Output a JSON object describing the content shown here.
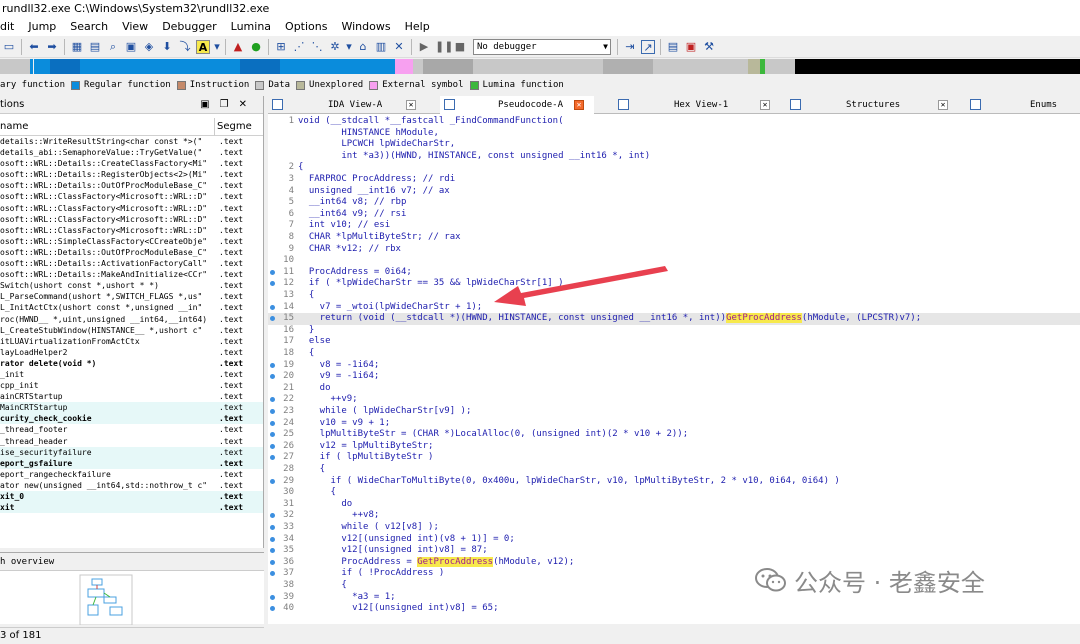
{
  "window": {
    "title": "rundll32.exe C:\\Windows\\System32\\rundll32.exe"
  },
  "menu": [
    "dit",
    "Jump",
    "Search",
    "View",
    "Debugger",
    "Lumina",
    "Options",
    "Windows",
    "Help"
  ],
  "toolbar": {
    "debugger_select": "No debugger"
  },
  "legend": [
    {
      "label": "ary function",
      "color": "#e8e8b0"
    },
    {
      "label": "Regular function",
      "color": "#0a8cdc"
    },
    {
      "label": "Instruction",
      "color": "#c58a6a"
    },
    {
      "label": "Data",
      "color": "#c8c8c8"
    },
    {
      "label": "Unexplored",
      "color": "#b8b89a"
    },
    {
      "label": "External symbol",
      "color": "#f7a0f0"
    },
    {
      "label": "Lumina function",
      "color": "#3cb83c"
    }
  ],
  "functions_panel": {
    "title": "tions",
    "col_name": " name",
    "col_segment": "Segme",
    "rows": [
      {
        "name": "details::WriteResultString<char const *>(\"",
        "seg": ".text",
        "hl": false,
        "bold": false
      },
      {
        "name": "details_abi::SemaphoreValue::TryGetValue(\"",
        "seg": ".text",
        "hl": false,
        "bold": false
      },
      {
        "name": "osoft::WRL::Details::CreateClassFactory<Mi\"",
        "seg": ".text",
        "hl": false,
        "bold": false
      },
      {
        "name": "osoft::WRL::Details::RegisterObjects<2>(Mi\"",
        "seg": ".text",
        "hl": false,
        "bold": false
      },
      {
        "name": "osoft::WRL::Details::OutOfProcModuleBase_C\"",
        "seg": ".text",
        "hl": false,
        "bold": false
      },
      {
        "name": "osoft::WRL::ClassFactory<Microsoft::WRL::D\"",
        "seg": ".text",
        "hl": false,
        "bold": false
      },
      {
        "name": "osoft::WRL::ClassFactory<Microsoft::WRL::D\"",
        "seg": ".text",
        "hl": false,
        "bold": false
      },
      {
        "name": "osoft::WRL::ClassFactory<Microsoft::WRL::D\"",
        "seg": ".text",
        "hl": false,
        "bold": false
      },
      {
        "name": "osoft::WRL::ClassFactory<Microsoft::WRL::D\"",
        "seg": ".text",
        "hl": false,
        "bold": false
      },
      {
        "name": "osoft::WRL::SimpleClassFactory<CCreateObje\"",
        "seg": ".text",
        "hl": false,
        "bold": false
      },
      {
        "name": "osoft::WRL::Details::OutOfProcModuleBase_C\"",
        "seg": ".text",
        "hl": false,
        "bold": false
      },
      {
        "name": "osoft::WRL::Details::ActivationFactoryCall\"",
        "seg": ".text",
        "hl": false,
        "bold": false
      },
      {
        "name": "osoft::WRL::Details::MakeAndInitialize<CCr\"",
        "seg": ".text",
        "hl": false,
        "bold": false
      },
      {
        "name": "Switch(ushort const *,ushort * *)",
        "seg": ".text",
        "hl": false,
        "bold": false
      },
      {
        "name": "L_ParseCommand(ushort *,SWITCH_FLAGS *,us\"",
        "seg": ".text",
        "hl": false,
        "bold": false
      },
      {
        "name": "L_InitActCtx(ushort const *,unsigned __in\"",
        "seg": ".text",
        "hl": false,
        "bold": false
      },
      {
        "name": "roc(HWND__ *,uint,unsigned __int64,__int64)",
        "seg": ".text",
        "hl": false,
        "bold": false
      },
      {
        "name": "L_CreateStubWindow(HINSTANCE__ *,ushort c\"",
        "seg": ".text",
        "hl": false,
        "bold": false
      },
      {
        "name": "itLUAVirtualizationFromActCtx",
        "seg": ".text",
        "hl": false,
        "bold": false
      },
      {
        "name": "layLoadHelper2",
        "seg": ".text",
        "hl": false,
        "bold": false
      },
      {
        "name": "rator delete(void *)",
        "seg": ".text",
        "hl": false,
        "bold": true
      },
      {
        "name": "_init",
        "seg": ".text",
        "hl": false,
        "bold": false
      },
      {
        "name": "cpp_init",
        "seg": ".text",
        "hl": false,
        "bold": false
      },
      {
        "name": "ainCRTStartup",
        "seg": ".text",
        "hl": false,
        "bold": false
      },
      {
        "name": "MainCRTStartup",
        "seg": ".text",
        "hl": true,
        "bold": false
      },
      {
        "name": "curity_check_cookie",
        "seg": ".text",
        "hl": true,
        "bold": true
      },
      {
        "name": "_thread_footer",
        "seg": ".text",
        "hl": false,
        "bold": false
      },
      {
        "name": "_thread_header",
        "seg": ".text",
        "hl": false,
        "bold": false
      },
      {
        "name": "ise_securityfailure",
        "seg": ".text",
        "hl": true,
        "bold": false
      },
      {
        "name": "eport_gsfailure",
        "seg": ".text",
        "hl": true,
        "bold": true
      },
      {
        "name": "eport_rangecheckfailure",
        "seg": ".text",
        "hl": false,
        "bold": false
      },
      {
        "name": "ator new(unsigned __int64,std::nothrow_t c\"",
        "seg": ".text",
        "hl": false,
        "bold": false
      },
      {
        "name": "xit_0",
        "seg": ".text",
        "hl": true,
        "bold": true
      },
      {
        "name": "xit",
        "seg": ".text",
        "hl": true,
        "bold": true
      }
    ],
    "status": "3 of 181"
  },
  "overview_panel": {
    "title": "h overview"
  },
  "tabs": [
    {
      "label": "IDA View-A",
      "active": false
    },
    {
      "label": "Pseudocode-A",
      "active": true
    },
    {
      "label": "Hex View-1",
      "active": false
    },
    {
      "label": "Structures",
      "active": false
    },
    {
      "label": "Enums",
      "active": false
    }
  ],
  "code_lines": [
    {
      "n": "1",
      "dot": false,
      "text": "void (__stdcall *__fastcall _FindCommandFunction("
    },
    {
      "n": "",
      "dot": false,
      "text": "        HINSTANCE hModule,"
    },
    {
      "n": "",
      "dot": false,
      "text": "        LPCWCH lpWideCharStr,"
    },
    {
      "n": "",
      "dot": false,
      "text": "        int *a3))(HWND, HINSTANCE, const unsigned __int16 *, int)"
    },
    {
      "n": "2",
      "dot": false,
      "text": "{"
    },
    {
      "n": "3",
      "dot": false,
      "text": "  FARPROC ProcAddress; // rdi"
    },
    {
      "n": "4",
      "dot": false,
      "text": "  unsigned __int16 v7; // ax"
    },
    {
      "n": "5",
      "dot": false,
      "text": "  __int64 v8; // rbp"
    },
    {
      "n": "6",
      "dot": false,
      "text": "  __int64 v9; // rsi"
    },
    {
      "n": "7",
      "dot": false,
      "text": "  int v10; // esi"
    },
    {
      "n": "8",
      "dot": false,
      "text": "  CHAR *lpMultiByteStr; // rax"
    },
    {
      "n": "9",
      "dot": false,
      "text": "  CHAR *v12; // rbx"
    },
    {
      "n": "10",
      "dot": false,
      "text": ""
    },
    {
      "n": "11",
      "dot": true,
      "text": "  ProcAddress = 0i64;"
    },
    {
      "n": "12",
      "dot": true,
      "text": "  if ( *lpWideCharStr == 35 && lpWideCharStr[1] )"
    },
    {
      "n": "13",
      "dot": false,
      "text": "  {"
    },
    {
      "n": "14",
      "dot": true,
      "text": "    v7 = _wtoi(lpWideCharStr + 1);"
    },
    {
      "n": "15",
      "dot": true,
      "text": "    return (void (__stdcall *)(HWND, HINSTANCE, const unsigned __int16 *, int))GetProcAddress(hModule, (LPCSTR)v7);",
      "cur": true
    },
    {
      "n": "16",
      "dot": false,
      "text": "  }"
    },
    {
      "n": "17",
      "dot": false,
      "text": "  else"
    },
    {
      "n": "18",
      "dot": false,
      "text": "  {"
    },
    {
      "n": "19",
      "dot": true,
      "text": "    v8 = -1i64;"
    },
    {
      "n": "20",
      "dot": true,
      "text": "    v9 = -1i64;"
    },
    {
      "n": "21",
      "dot": false,
      "text": "    do"
    },
    {
      "n": "22",
      "dot": true,
      "text": "      ++v9;"
    },
    {
      "n": "23",
      "dot": true,
      "text": "    while ( lpWideCharStr[v9] );"
    },
    {
      "n": "24",
      "dot": true,
      "text": "    v10 = v9 + 1;"
    },
    {
      "n": "25",
      "dot": true,
      "text": "    lpMultiByteStr = (CHAR *)LocalAlloc(0, (unsigned int)(2 * v10 + 2));"
    },
    {
      "n": "26",
      "dot": true,
      "text": "    v12 = lpMultiByteStr;"
    },
    {
      "n": "27",
      "dot": true,
      "text": "    if ( lpMultiByteStr )"
    },
    {
      "n": "28",
      "dot": false,
      "text": "    {"
    },
    {
      "n": "29",
      "dot": true,
      "text": "      if ( WideCharToMultiByte(0, 0x400u, lpWideCharStr, v10, lpMultiByteStr, 2 * v10, 0i64, 0i64) )"
    },
    {
      "n": "30",
      "dot": false,
      "text": "      {"
    },
    {
      "n": "31",
      "dot": false,
      "text": "        do"
    },
    {
      "n": "32",
      "dot": true,
      "text": "          ++v8;"
    },
    {
      "n": "33",
      "dot": true,
      "text": "        while ( v12[v8] );"
    },
    {
      "n": "34",
      "dot": true,
      "text": "        v12[(unsigned int)(v8 + 1)] = 0;"
    },
    {
      "n": "35",
      "dot": true,
      "text": "        v12[(unsigned int)v8] = 87;"
    },
    {
      "n": "36",
      "dot": true,
      "text": "        ProcAddress = GetProcAddress(hModule, v12);"
    },
    {
      "n": "37",
      "dot": true,
      "text": "        if ( !ProcAddress )"
    },
    {
      "n": "38",
      "dot": false,
      "text": "        {"
    },
    {
      "n": "39",
      "dot": true,
      "text": "          *a3 = 1;"
    },
    {
      "n": "40",
      "dot": true,
      "text": "          v12[(unsigned int)v8] = 65;"
    }
  ],
  "watermark": {
    "text": "公众号 · 老鑫安全"
  }
}
